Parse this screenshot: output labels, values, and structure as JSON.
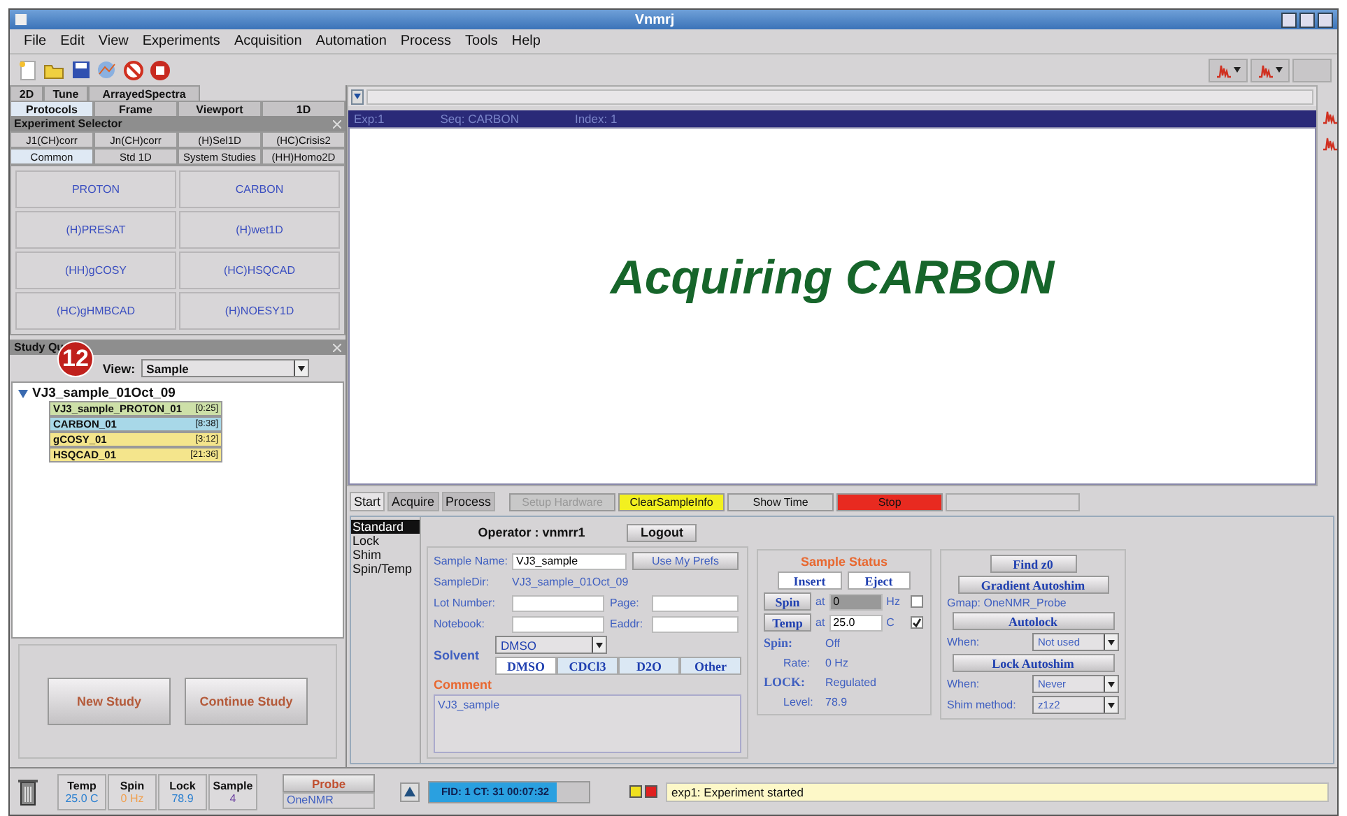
{
  "window": {
    "title": "Vnmrj"
  },
  "menu": [
    "File",
    "Edit",
    "View",
    "Experiments",
    "Acquisition",
    "Automation",
    "Process",
    "Tools",
    "Help"
  ],
  "left_tabs": {
    "row_1": [
      {
        "label": "2D",
        "selected": false
      },
      {
        "label": "Tune",
        "selected": false
      },
      {
        "label": "ArrayedSpectra",
        "selected": false
      }
    ],
    "row_2": [
      {
        "label": "Protocols",
        "selected": true
      },
      {
        "label": "Frame",
        "selected": false
      },
      {
        "label": "Viewport",
        "selected": false
      },
      {
        "label": "1D",
        "selected": false
      }
    ]
  },
  "experiment_selector": {
    "title": "Experiment Selector",
    "tabs_row_1": [
      {
        "label": "J1(CH)corr",
        "selected": false
      },
      {
        "label": "Jn(CH)corr",
        "selected": false
      },
      {
        "label": "(H)Sel1D",
        "selected": false
      },
      {
        "label": "(HC)Crisis2",
        "selected": false
      }
    ],
    "tabs_row_2": [
      {
        "label": "Common",
        "selected": true
      },
      {
        "label": "Std 1D",
        "selected": false
      },
      {
        "label": "System Studies",
        "selected": false
      },
      {
        "label": "(HH)Homo2D",
        "selected": false
      }
    ],
    "protocols": [
      "PROTON",
      "CARBON",
      "(H)PRESAT",
      "(H)wet1D",
      "(HH)gCOSY",
      "(HC)HSQCAD",
      "(HC)gHMBCAD",
      "(H)NOESY1D"
    ]
  },
  "study_queue": {
    "title": "Study Qu",
    "callout": "12",
    "view_label": "View:",
    "view_value": "Sample",
    "sample": {
      "name": "VJ3_sample_01Oct_09",
      "expanded": true,
      "children": [
        {
          "name": "VJ3_sample_PROTON_01",
          "time": "[0:25]",
          "color": "#cde0a8"
        },
        {
          "name": "CARBON_01",
          "time": "[8:38]",
          "color": "#a8d8e8"
        },
        {
          "name": "gCOSY_01",
          "time": "[3:12]",
          "color": "#f4e58c"
        },
        {
          "name": "HSQCAD_01",
          "time": "[21:36]",
          "color": "#f4e58c"
        }
      ]
    },
    "buttons": [
      "New Study",
      "Continue Study"
    ]
  },
  "graphics": {
    "header": [
      "Exp:1",
      "Seq: CARBON",
      "Index: 1"
    ],
    "message": "Acquiring CARBON"
  },
  "control_panel": {
    "tabs": [
      {
        "label": "Start",
        "selected": true
      },
      {
        "label": "Acquire",
        "selected": false
      },
      {
        "label": "Process",
        "selected": false
      }
    ],
    "buttons": [
      {
        "label": "Setup Hardware",
        "disabled": true,
        "color": "#c8c8c8"
      },
      {
        "label": "ClearSampleInfo",
        "disabled": false,
        "color": "#f2f020"
      },
      {
        "label": "Show Time",
        "disabled": false,
        "color": "#d4d4d4"
      },
      {
        "label": "Stop",
        "disabled": false,
        "color": "#e82a20"
      }
    ],
    "sections": [
      {
        "label": "Standard",
        "selected": true
      },
      {
        "label": "Lock",
        "selected": false
      },
      {
        "label": "Shim",
        "selected": false
      },
      {
        "label": "Spin/Temp",
        "selected": false
      }
    ],
    "operator": "Operator : vnmrr1",
    "logout": "Logout",
    "sample_name": {
      "label": "Sample Name:",
      "value": "VJ3_sample"
    },
    "use_prefs": "Use My Prefs",
    "sample_dir": {
      "label": "SampleDir:",
      "value": "VJ3_sample_01Oct_09"
    },
    "lot_number": "Lot Number:",
    "page": "Page:",
    "notebook": "Notebook:",
    "eaddr": "Eaddr:",
    "solvent": {
      "label": "Solvent",
      "value": "DMSO",
      "options": [
        {
          "label": "DMSO",
          "selected": true
        },
        {
          "label": "CDCl3",
          "selected": false
        },
        {
          "label": "D2O",
          "selected": false
        },
        {
          "label": "Other",
          "selected": false
        }
      ]
    },
    "comment": {
      "label": "Comment",
      "value": "VJ3_sample"
    }
  },
  "sample_status": {
    "title": "Sample Status",
    "insert": "Insert",
    "eject": "Eject",
    "controls": [
      {
        "label": "Spin",
        "at": "at",
        "value": "0",
        "unit": "Hz",
        "checked": false
      },
      {
        "label": "Temp",
        "at": "at",
        "value": "25.0",
        "unit": "C",
        "checked": true
      }
    ],
    "states": [
      {
        "label": "Spin:",
        "value": "Off",
        "kind": "heading"
      },
      {
        "label": "Rate:",
        "value": "0 Hz",
        "kind": "sub"
      },
      {
        "label": "LOCK:",
        "value": "Regulated",
        "kind": "heading"
      },
      {
        "label": "Level:",
        "value": "78.9",
        "kind": "sub"
      }
    ]
  },
  "shim": {
    "find_z0": "Find z0",
    "gradient": "Gradient Autoshim",
    "gmap": "Gmap: OneNMR_Probe",
    "autolock": "Autolock",
    "autolock_when": {
      "label": "When:",
      "value": "Not used"
    },
    "lock_autoshim": "Lock Autoshim",
    "lock_when": {
      "label": "When:",
      "value": "Never"
    },
    "shim_method": {
      "label": "Shim method:",
      "value": "z1z2"
    }
  },
  "status_bar": {
    "readouts": [
      {
        "label": "Temp",
        "value": "25.0 C",
        "color": "#2a7fd0"
      },
      {
        "label": "Spin",
        "value": "0 Hz",
        "color": "#f0a050"
      },
      {
        "label": "Lock",
        "value": "78.9",
        "color": "#2a7fd0"
      },
      {
        "label": "Sample",
        "value": "4",
        "color": "#6a3fa0"
      }
    ],
    "probe": {
      "label": "Probe",
      "value": "OneNMR"
    },
    "acquisition": {
      "text": "FID: 1 CT: 31 00:07:32",
      "level": 0.8
    },
    "message": "exp1:  Experiment started"
  }
}
